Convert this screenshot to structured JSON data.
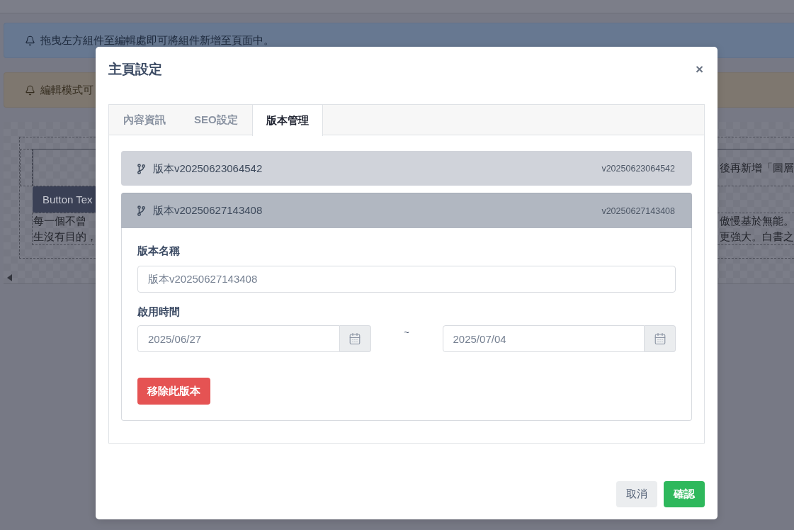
{
  "page": {
    "alerts": [
      {
        "kind": "info",
        "text": "拖曳左方組件至編輯處即可將組件新增至頁面中。"
      },
      {
        "kind": "warning",
        "text": "編輯模式可"
      }
    ],
    "canvas": {
      "layer_text": "後再新增「圖層",
      "button_label": "Button Tex",
      "paragraph_left": [
        "每一個不曾",
        "生沒有目的，"
      ],
      "paragraph_right": [
        "傲慢基於無能。",
        "更強大。白書之"
      ]
    }
  },
  "modal": {
    "title": "主頁設定",
    "close": "×",
    "tabs": [
      {
        "label": "內容資訊",
        "selected": false
      },
      {
        "label": "SEO設定",
        "selected": false
      },
      {
        "label": "版本管理",
        "selected": true
      }
    ],
    "versions": [
      {
        "name": "版本v20250623064542",
        "code": "v20250623064542",
        "expanded": false
      },
      {
        "name": "版本v20250627143408",
        "code": "v20250627143408",
        "expanded": true,
        "details": {
          "name_label": "版本名稱",
          "name_value": "版本v20250627143408",
          "period_label": "啟用時間",
          "start_date": "2025/06/27",
          "separator": "~",
          "end_date": "2025/07/04",
          "remove_button": "移除此版本"
        }
      }
    ],
    "buttons": [
      {
        "kind": "secondary",
        "label": "取消"
      },
      {
        "kind": "primary",
        "label": "確認"
      }
    ]
  }
}
